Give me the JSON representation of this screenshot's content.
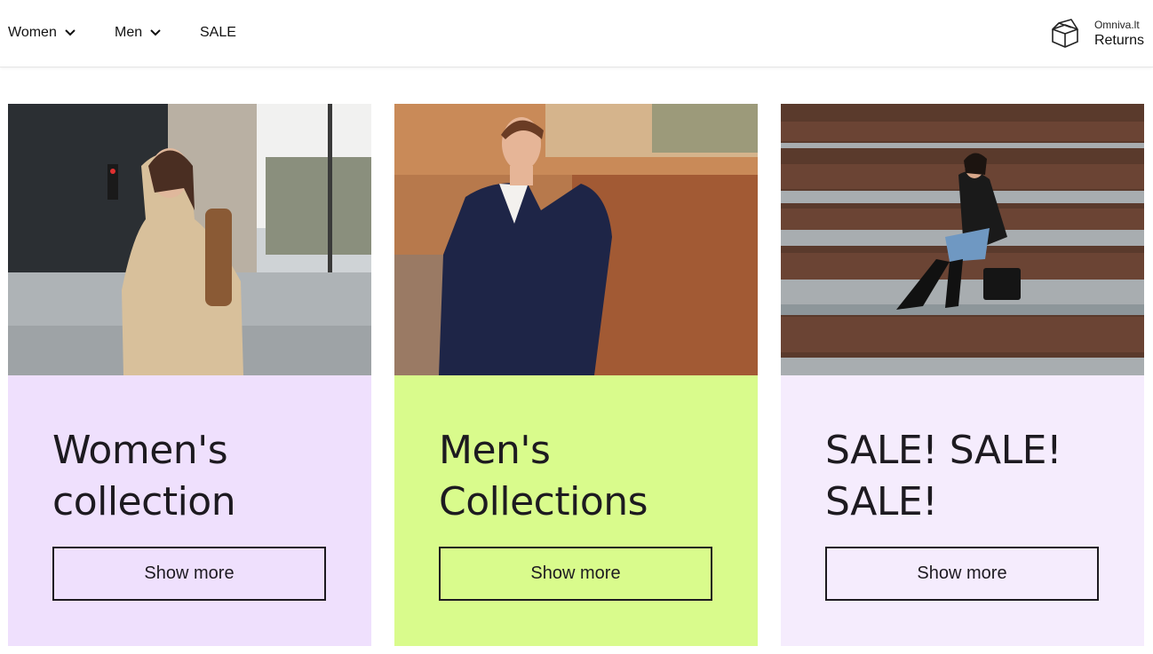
{
  "nav": {
    "items": [
      {
        "label": "Women",
        "has_dropdown": true
      },
      {
        "label": "Men",
        "has_dropdown": true
      },
      {
        "label": "SALE",
        "has_dropdown": false
      }
    ],
    "returns": {
      "brand": "Omniva.lt",
      "label": "Returns",
      "icon": "box-icon"
    }
  },
  "cards": [
    {
      "title": "Women's collection",
      "button": "Show more",
      "bg": "#efe0fd"
    },
    {
      "title": "Men's Collections",
      "button": "Show more",
      "bg": "#d9fb8c"
    },
    {
      "title": "SALE! SALE! SALE!",
      "button": "Show more",
      "bg": "#f5ecfd"
    }
  ],
  "colors": {
    "text": "#1d1a20",
    "accent_lime": "#d9fb8c",
    "accent_lilac": "#efe0fd"
  }
}
